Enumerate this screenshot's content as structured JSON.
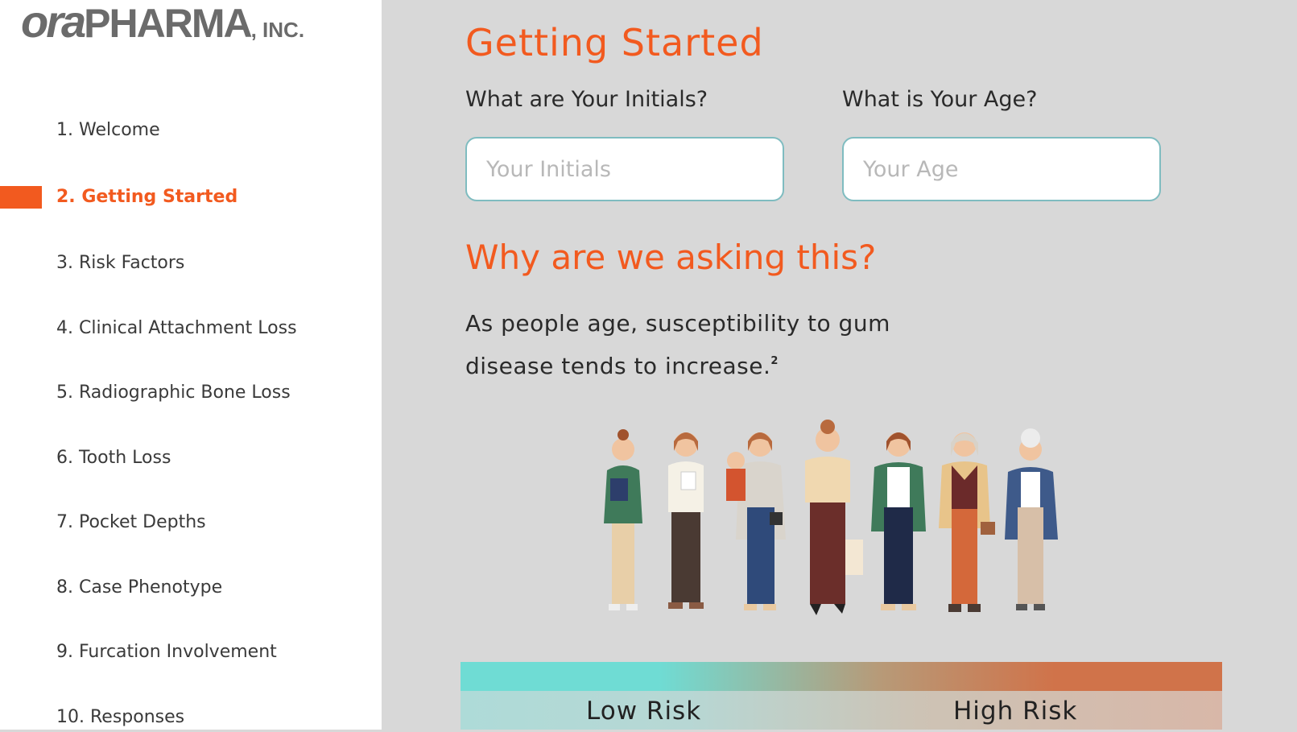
{
  "brand": {
    "logo_part1": "ora",
    "logo_part2": "PHARMA",
    "logo_part3": ", INC."
  },
  "sidebar": {
    "items": [
      {
        "label": "1. Welcome"
      },
      {
        "label": "2. Getting Started",
        "active": true
      },
      {
        "label": "3. Risk Factors"
      },
      {
        "label": "4. Clinical Attachment Loss"
      },
      {
        "label": "5. Radiographic Bone Loss"
      },
      {
        "label": "6. Tooth Loss"
      },
      {
        "label": "7. Pocket Depths"
      },
      {
        "label": "8. Case Phenotype"
      },
      {
        "label": "9. Furcation Involvement"
      },
      {
        "label": "10. Responses"
      }
    ]
  },
  "main": {
    "title": "Getting Started",
    "initials": {
      "label": "What are Your Initials?",
      "placeholder": "Your Initials",
      "value": ""
    },
    "age": {
      "label": "What is Your Age?",
      "placeholder": "Your Age",
      "value": ""
    },
    "why_heading": "Why are we asking this?",
    "explanation": "As people age, susceptibility to gum disease tends to increase.",
    "footnote": "2",
    "risk": {
      "low_label": "Low Risk",
      "high_label": "High Risk"
    }
  },
  "colors": {
    "accent": "#f25a1f",
    "input_border": "#7fbcc0",
    "low_risk": "#6fdcd4",
    "high_risk": "#d0734a"
  }
}
